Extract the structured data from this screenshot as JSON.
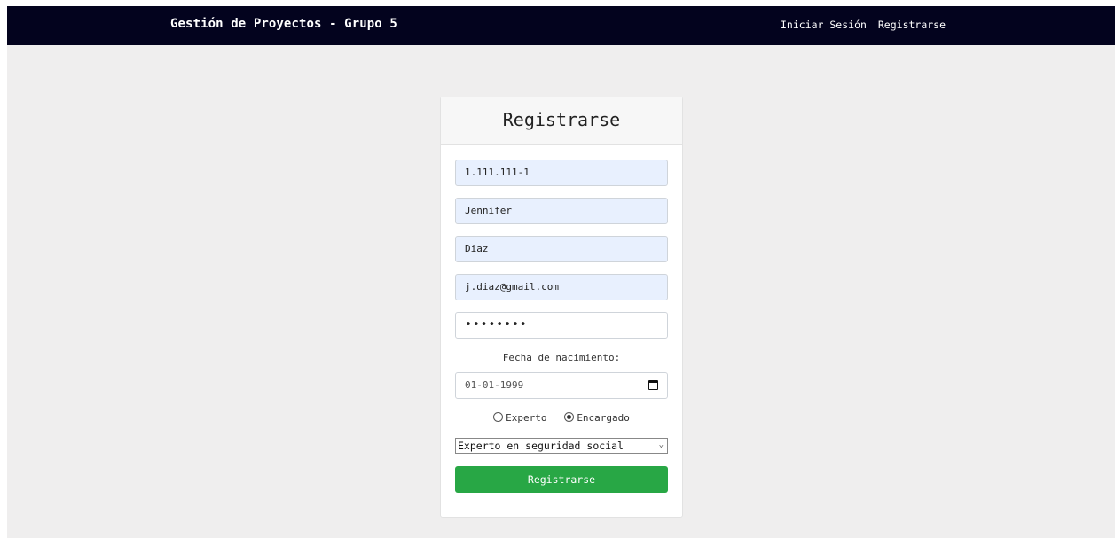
{
  "navbar": {
    "brand": "Gestión de Proyectos - Grupo 5",
    "links": [
      "Iniciar Sesión",
      "Registrarse"
    ]
  },
  "form": {
    "title": "Registrarse",
    "rut_value": "1.111.111-1",
    "first_name_value": "Jennifer",
    "last_name_value": "Diaz",
    "email_value": "j.diaz@gmail.com",
    "password_mask": "••••••••",
    "birthdate_label": "Fecha de nacimiento:",
    "birthdate_value": "01-01-1999",
    "role_options": [
      {
        "label": "Experto",
        "checked": false
      },
      {
        "label": "Encargado",
        "checked": true
      }
    ],
    "specialty_selected": "Experto en seguridad social",
    "submit_label": "Registrarse"
  },
  "colors": {
    "navbar_bg": "#03031e",
    "page_bg": "#efeeee",
    "submit_bg": "#28a745",
    "autofill_bg": "#e8f0fe"
  },
  "icons": [
    "calendar-icon",
    "chevron-down-icon"
  ]
}
